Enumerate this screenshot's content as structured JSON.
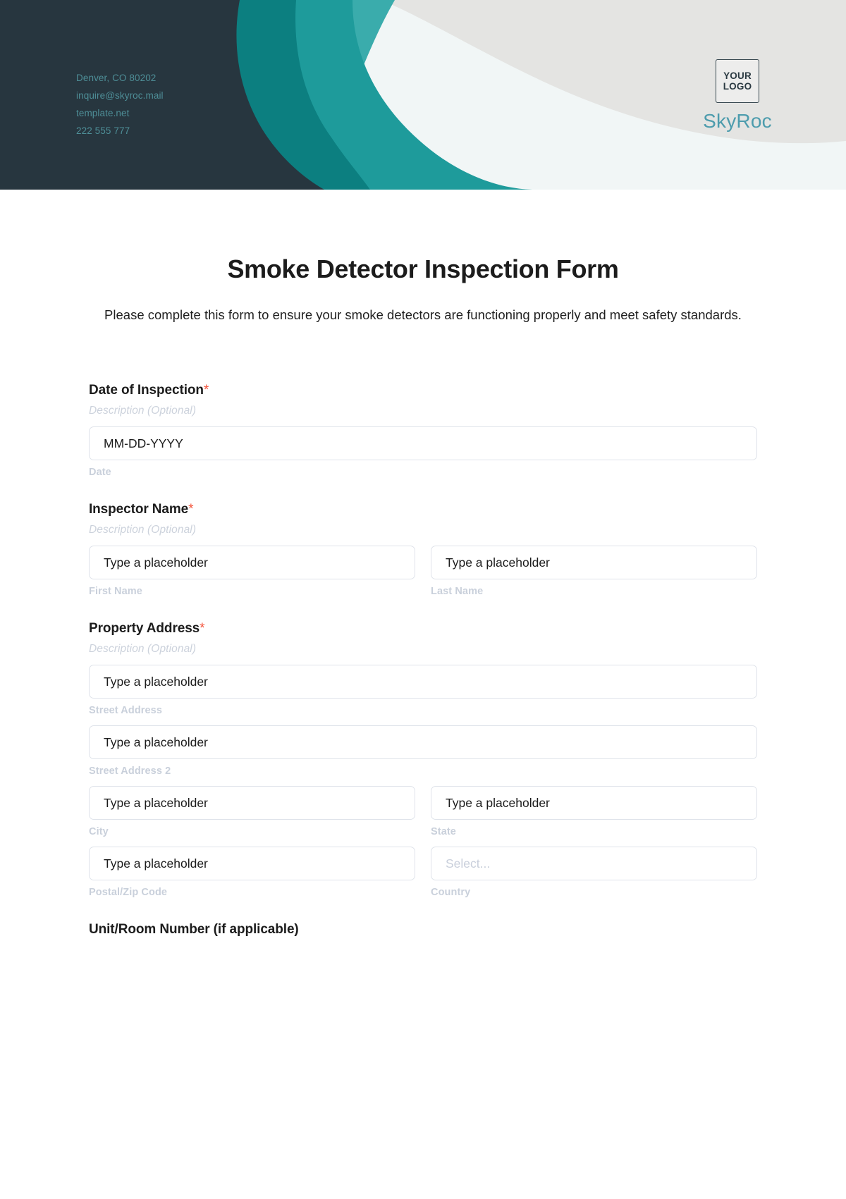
{
  "header": {
    "contact_lines": [
      "Denver, CO 80202",
      "inquire@skyroc.mail",
      "template.net",
      "222 555 777"
    ],
    "logo_line1": "YOUR",
    "logo_line2": "LOGO",
    "brand_name": "SkyRoc",
    "colors": {
      "navy": "#27363f",
      "dark_teal": "#0c7f80",
      "mid_teal": "#1e9b9b",
      "light_teal": "#3aacac",
      "grey_wave": "#e4e4e2",
      "background": "#f1f6f6",
      "brand_text": "#4d9cad",
      "contact_text": "#4e8e97"
    }
  },
  "page": {
    "title": "Smoke Detector Inspection Form",
    "subtitle": "Please complete this form to ensure your smoke detectors are functioning properly and meet safety standards.",
    "required_marker": "*",
    "description_optional": "Description (Optional)",
    "accent_required": "#f4553d"
  },
  "fields": {
    "date_of_inspection": {
      "label": "Date of Inspection",
      "required": true,
      "description": "Description (Optional)",
      "input_value": "MM-DD-YYYY",
      "sub_label": "Date"
    },
    "inspector_name": {
      "label": "Inspector Name",
      "required": true,
      "description": "Description (Optional)",
      "first": {
        "value": "Type a placeholder",
        "sub_label": "First Name"
      },
      "last": {
        "value": "Type a placeholder",
        "sub_label": "Last Name"
      }
    },
    "property_address": {
      "label": "Property Address",
      "required": true,
      "description": "Description (Optional)",
      "street1": {
        "value": "Type a placeholder",
        "sub_label": "Street Address"
      },
      "street2": {
        "value": "Type a placeholder",
        "sub_label": "Street Address 2"
      },
      "city": {
        "value": "Type a placeholder",
        "sub_label": "City"
      },
      "state": {
        "value": "Type a placeholder",
        "sub_label": "State"
      },
      "postal": {
        "value": "Type a placeholder",
        "sub_label": "Postal/Zip Code"
      },
      "country": {
        "value": "Select...",
        "sub_label": "Country"
      }
    },
    "unit_room_number": {
      "label": "Unit/Room Number (if applicable)",
      "required": false
    }
  }
}
